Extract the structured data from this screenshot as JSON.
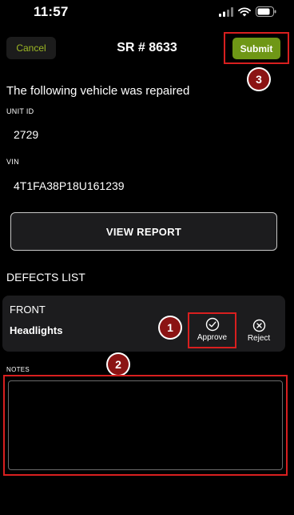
{
  "status_bar": {
    "time": "11:57"
  },
  "header": {
    "cancel_label": "Cancel",
    "title": "SR # 8633",
    "submit_label": "Submit"
  },
  "intro_text": "The following vehicle was repaired",
  "unit": {
    "label": "UNIT ID",
    "value": "2729"
  },
  "vin": {
    "label": "VIN",
    "value": "4T1FA38P18U161239"
  },
  "view_report_label": "VIEW REPORT",
  "defects": {
    "title": "DEFECTS LIST",
    "items": [
      {
        "section": "FRONT",
        "name": "Headlights",
        "approve_label": "Approve",
        "reject_label": "Reject"
      }
    ]
  },
  "notes": {
    "label": "NOTES",
    "value": ""
  },
  "annotations": [
    "1",
    "2",
    "3"
  ],
  "colors": {
    "accent_green": "#6f9716",
    "cancel_text": "#9db824",
    "highlight_red": "#d81f1f",
    "marker_fill": "#8b1414",
    "card_bg": "#1c1c1e"
  },
  "icons": [
    "signal-icon",
    "wifi-icon",
    "battery-icon",
    "check-circle-icon",
    "x-circle-icon"
  ]
}
